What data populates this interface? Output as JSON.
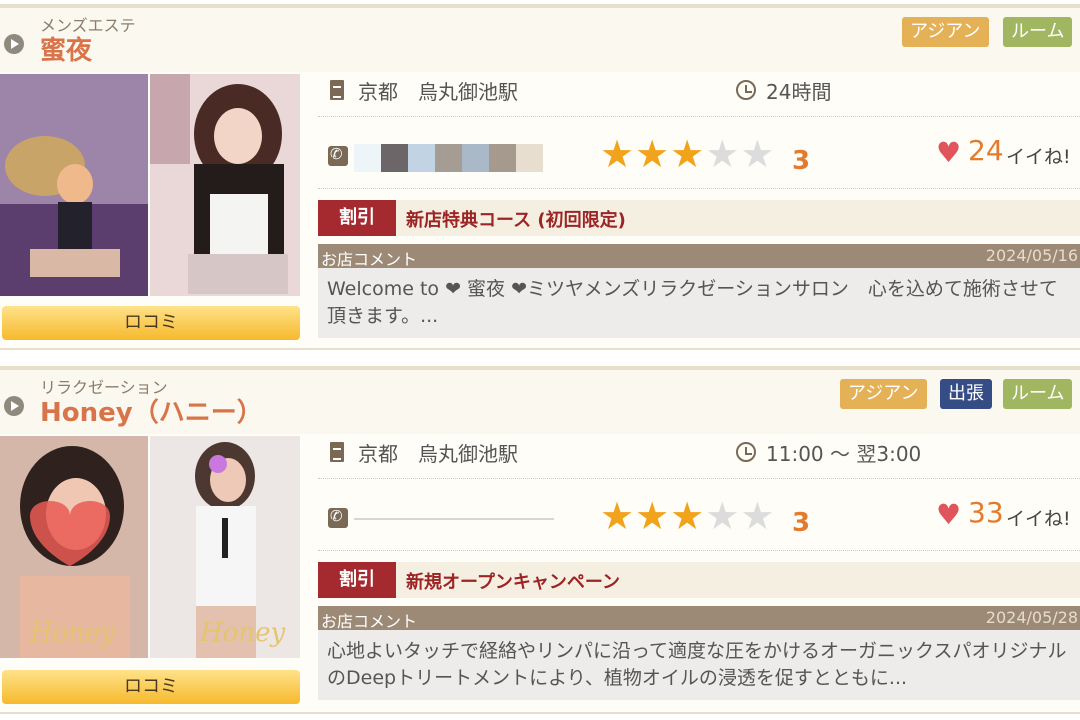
{
  "listings": [
    {
      "category": "メンズエステ",
      "name": "蜜夜",
      "tags": [
        "アジアン",
        "ルーム"
      ],
      "location": "京都　烏丸御池駅",
      "hours": "24時間",
      "rating_value": 3,
      "rating_display": "3",
      "likes": "24",
      "likes_label": "イイね!",
      "discount_badge": "割引",
      "discount_text": "新店特典コース (初回限定)",
      "comment_label": "お店コメント",
      "comment_date": "2024/05/16",
      "comment_text": "Welcome to ❤ 蜜夜 ❤ミツヤメンズリラクゼーションサロン　心を込めて施術させて頂きます。...",
      "review_button": "ロコミ"
    },
    {
      "category": "リラクゼーション",
      "name": "Honey（ハニー）",
      "tags": [
        "アジアン",
        "出張",
        "ルーム"
      ],
      "location": "京都　烏丸御池駅",
      "hours": "11:00 ～ 翌3:00",
      "rating_value": 3,
      "rating_display": "3",
      "likes": "33",
      "likes_label": "イイね!",
      "discount_badge": "割引",
      "discount_text": "新規オープンキャンペーン",
      "comment_label": "お店コメント",
      "comment_date": "2024/05/28",
      "comment_text": "心地よいタッチで経絡やリンパに沿って適度な圧をかけるオーガニックスパオリジナルのDeepトリートメントにより、植物オイルの浸透を促すとともに...",
      "review_button": "ロコミ"
    }
  ],
  "icons": {
    "arrow": "arrow-right-circle-icon",
    "location": "document-pin-icon",
    "clock": "clock-icon",
    "phone": "phone-icon",
    "star": "star-icon",
    "heart": "heart-icon"
  },
  "colors": {
    "accent_name": "#d9744a",
    "discount": "#a52a2f",
    "star_on": "#f2a31c",
    "heart": "#e0545c",
    "tag_asian": "#e5b157",
    "tag_room": "#a1b660",
    "tag_trip": "#364c85"
  }
}
